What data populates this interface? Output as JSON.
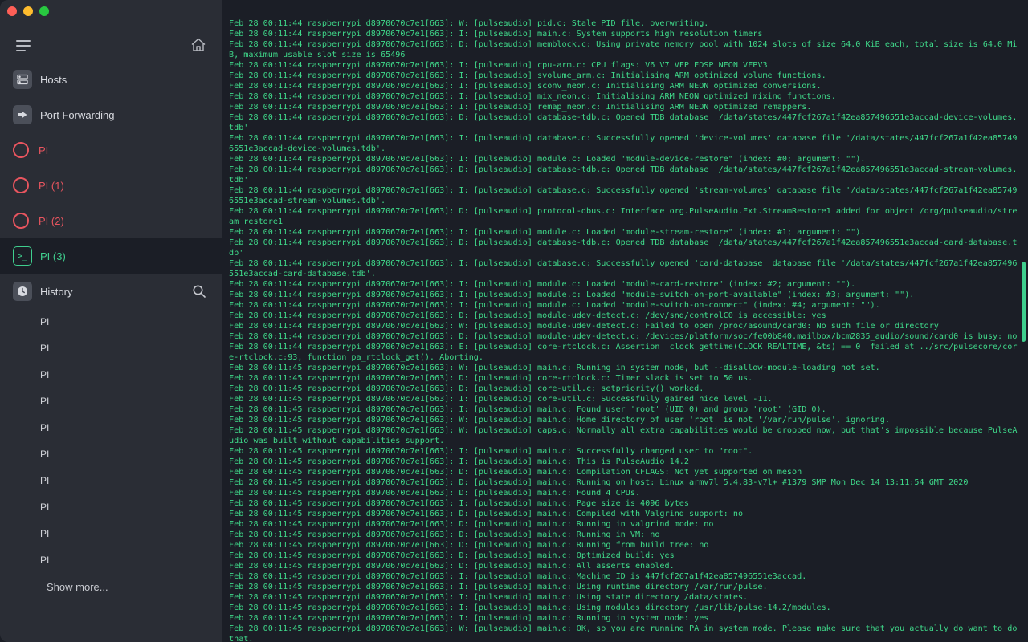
{
  "sidebar": {
    "nav": [
      {
        "label": "Hosts",
        "icon": "hosts-icon"
      },
      {
        "label": "Port Forwarding",
        "icon": "port-forwarding-icon"
      }
    ],
    "hosts": [
      {
        "label": "PI"
      },
      {
        "label": "PI (1)"
      },
      {
        "label": "PI (2)"
      }
    ],
    "active_session": {
      "label": "PI (3)",
      "icon": "terminal-icon"
    },
    "history": {
      "title": "History",
      "items": [
        "PI",
        "PI",
        "PI",
        "PI",
        "PI",
        "PI",
        "PI",
        "PI",
        "PI",
        "PI"
      ],
      "show_more": "Show more..."
    }
  },
  "colors": {
    "accent": "#3fcf8e",
    "host_red": "#e8555f",
    "sidebar_bg": "#2a2d35",
    "terminal_bg": "#1b1e26"
  },
  "terminal": {
    "lines": [
      "Feb 28 00:11:44 raspberrypi d8970670c7e1[663]: W: [pulseaudio] pid.c: Stale PID file, overwriting.",
      "Feb 28 00:11:44 raspberrypi d8970670c7e1[663]: I: [pulseaudio] main.c: System supports high resolution timers",
      "Feb 28 00:11:44 raspberrypi d8970670c7e1[663]: D: [pulseaudio] memblock.c: Using private memory pool with 1024 slots of size 64.0 KiB each, total size is 64.0 MiB, maximum usable slot size is 65496",
      "Feb 28 00:11:44 raspberrypi d8970670c7e1[663]: I: [pulseaudio] cpu-arm.c: CPU flags: V6 V7 VFP EDSP NEON VFPV3",
      "Feb 28 00:11:44 raspberrypi d8970670c7e1[663]: I: [pulseaudio] svolume_arm.c: Initialising ARM optimized volume functions.",
      "Feb 28 00:11:44 raspberrypi d8970670c7e1[663]: I: [pulseaudio] sconv_neon.c: Initialising ARM NEON optimized conversions.",
      "Feb 28 00:11:44 raspberrypi d8970670c7e1[663]: I: [pulseaudio] mix_neon.c: Initialising ARM NEON optimized mixing functions.",
      "Feb 28 00:11:44 raspberrypi d8970670c7e1[663]: I: [pulseaudio] remap_neon.c: Initialising ARM NEON optimized remappers.",
      "Feb 28 00:11:44 raspberrypi d8970670c7e1[663]: D: [pulseaudio] database-tdb.c: Opened TDB database '/data/states/447fcf267a1f42ea857496551e3accad-device-volumes.tdb'",
      "Feb 28 00:11:44 raspberrypi d8970670c7e1[663]: I: [pulseaudio] database.c: Successfully opened 'device-volumes' database file '/data/states/447fcf267a1f42ea857496551e3accad-device-volumes.tdb'.",
      "Feb 28 00:11:44 raspberrypi d8970670c7e1[663]: I: [pulseaudio] module.c: Loaded \"module-device-restore\" (index: #0; argument: \"\").",
      "Feb 28 00:11:44 raspberrypi d8970670c7e1[663]: D: [pulseaudio] database-tdb.c: Opened TDB database '/data/states/447fcf267a1f42ea857496551e3accad-stream-volumes.tdb'",
      "Feb 28 00:11:44 raspberrypi d8970670c7e1[663]: I: [pulseaudio] database.c: Successfully opened 'stream-volumes' database file '/data/states/447fcf267a1f42ea857496551e3accad-stream-volumes.tdb'.",
      "Feb 28 00:11:44 raspberrypi d8970670c7e1[663]: D: [pulseaudio] protocol-dbus.c: Interface org.PulseAudio.Ext.StreamRestore1 added for object /org/pulseaudio/stream_restore1",
      "Feb 28 00:11:44 raspberrypi d8970670c7e1[663]: I: [pulseaudio] module.c: Loaded \"module-stream-restore\" (index: #1; argument: \"\").",
      "Feb 28 00:11:44 raspberrypi d8970670c7e1[663]: D: [pulseaudio] database-tdb.c: Opened TDB database '/data/states/447fcf267a1f42ea857496551e3accad-card-database.tdb'",
      "Feb 28 00:11:44 raspberrypi d8970670c7e1[663]: I: [pulseaudio] database.c: Successfully opened 'card-database' database file '/data/states/447fcf267a1f42ea857496551e3accad-card-database.tdb'.",
      "Feb 28 00:11:44 raspberrypi d8970670c7e1[663]: I: [pulseaudio] module.c: Loaded \"module-card-restore\" (index: #2; argument: \"\").",
      "Feb 28 00:11:44 raspberrypi d8970670c7e1[663]: I: [pulseaudio] module.c: Loaded \"module-switch-on-port-available\" (index: #3; argument: \"\").",
      "Feb 28 00:11:44 raspberrypi d8970670c7e1[663]: I: [pulseaudio] module.c: Loaded \"module-switch-on-connect\" (index: #4; argument: \"\").",
      "Feb 28 00:11:44 raspberrypi d8970670c7e1[663]: D: [pulseaudio] module-udev-detect.c: /dev/snd/controlC0 is accessible: yes",
      "Feb 28 00:11:44 raspberrypi d8970670c7e1[663]: W: [pulseaudio] module-udev-detect.c: Failed to open /proc/asound/card0: No such file or directory",
      "Feb 28 00:11:44 raspberrypi d8970670c7e1[663]: D: [pulseaudio] module-udev-detect.c: /devices/platform/soc/fe00b840.mailbox/bcm2835_audio/sound/card0 is busy: no",
      "Feb 28 00:11:44 raspberrypi d8970670c7e1[663]: E: [pulseaudio] core-rtclock.c: Assertion 'clock_gettime(CLOCK_REALTIME, &ts) == 0' failed at ../src/pulsecore/core-rtclock.c:93, function pa_rtclock_get(). Aborting.",
      "Feb 28 00:11:45 raspberrypi d8970670c7e1[663]: W: [pulseaudio] main.c: Running in system mode, but --disallow-module-loading not set.",
      "Feb 28 00:11:45 raspberrypi d8970670c7e1[663]: D: [pulseaudio] core-rtclock.c: Timer slack is set to 50 us.",
      "Feb 28 00:11:45 raspberrypi d8970670c7e1[663]: D: [pulseaudio] core-util.c: setpriority() worked.",
      "Feb 28 00:11:45 raspberrypi d8970670c7e1[663]: I: [pulseaudio] core-util.c: Successfully gained nice level -11.",
      "Feb 28 00:11:45 raspberrypi d8970670c7e1[663]: I: [pulseaudio] main.c: Found user 'root' (UID 0) and group 'root' (GID 0).",
      "Feb 28 00:11:45 raspberrypi d8970670c7e1[663]: W: [pulseaudio] main.c: Home directory of user 'root' is not '/var/run/pulse', ignoring.",
      "Feb 28 00:11:45 raspberrypi d8970670c7e1[663]: W: [pulseaudio] caps.c: Normally all extra capabilities would be dropped now, but that's impossible because PulseAudio was built without capabilities support.",
      "Feb 28 00:11:45 raspberrypi d8970670c7e1[663]: I: [pulseaudio] main.c: Successfully changed user to \"root\".",
      "Feb 28 00:11:45 raspberrypi d8970670c7e1[663]: I: [pulseaudio] main.c: This is PulseAudio 14.2",
      "Feb 28 00:11:45 raspberrypi d8970670c7e1[663]: D: [pulseaudio] main.c: Compilation CFLAGS: Not yet supported on meson",
      "Feb 28 00:11:45 raspberrypi d8970670c7e1[663]: D: [pulseaudio] main.c: Running on host: Linux armv7l 5.4.83-v7l+ #1379 SMP Mon Dec 14 13:11:54 GMT 2020",
      "Feb 28 00:11:45 raspberrypi d8970670c7e1[663]: D: [pulseaudio] main.c: Found 4 CPUs.",
      "Feb 28 00:11:45 raspberrypi d8970670c7e1[663]: I: [pulseaudio] main.c: Page size is 4096 bytes",
      "Feb 28 00:11:45 raspberrypi d8970670c7e1[663]: D: [pulseaudio] main.c: Compiled with Valgrind support: no",
      "Feb 28 00:11:45 raspberrypi d8970670c7e1[663]: D: [pulseaudio] main.c: Running in valgrind mode: no",
      "Feb 28 00:11:45 raspberrypi d8970670c7e1[663]: D: [pulseaudio] main.c: Running in VM: no",
      "Feb 28 00:11:45 raspberrypi d8970670c7e1[663]: D: [pulseaudio] main.c: Running from build tree: no",
      "Feb 28 00:11:45 raspberrypi d8970670c7e1[663]: D: [pulseaudio] main.c: Optimized build: yes",
      "Feb 28 00:11:45 raspberrypi d8970670c7e1[663]: D: [pulseaudio] main.c: All asserts enabled.",
      "Feb 28 00:11:45 raspberrypi d8970670c7e1[663]: I: [pulseaudio] main.c: Machine ID is 447fcf267a1f42ea857496551e3accad.",
      "Feb 28 00:11:45 raspberrypi d8970670c7e1[663]: I: [pulseaudio] main.c: Using runtime directory /var/run/pulse.",
      "Feb 28 00:11:45 raspberrypi d8970670c7e1[663]: I: [pulseaudio] main.c: Using state directory /data/states.",
      "Feb 28 00:11:45 raspberrypi d8970670c7e1[663]: I: [pulseaudio] main.c: Using modules directory /usr/lib/pulse-14.2/modules.",
      "Feb 28 00:11:45 raspberrypi d8970670c7e1[663]: I: [pulseaudio] main.c: Running in system mode: yes",
      "Feb 28 00:11:45 raspberrypi d8970670c7e1[663]: W: [pulseaudio] main.c: OK, so you are running PA in system mode. Please make sure that you actually do want to do that."
    ]
  }
}
